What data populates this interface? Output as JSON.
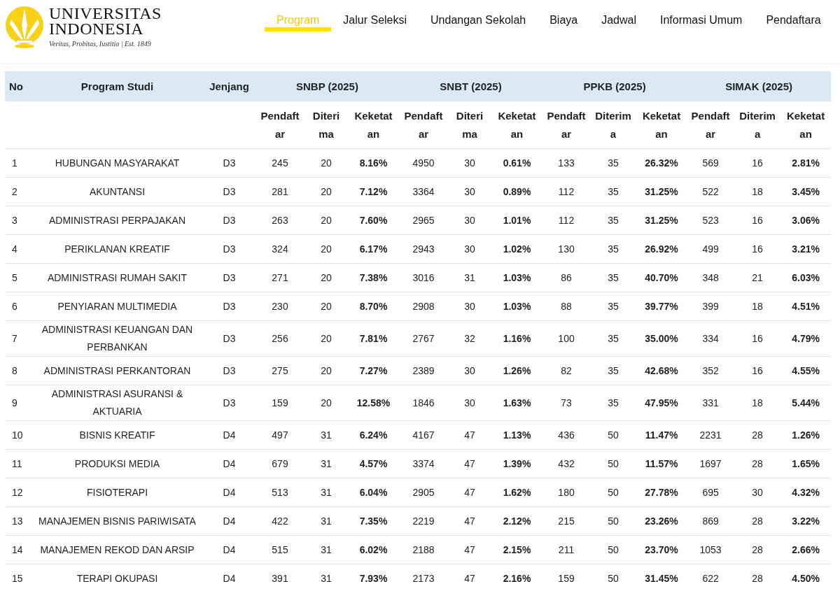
{
  "logo": {
    "name_line1": "UNIVERSITAS",
    "name_line2": "INDONESIA",
    "motto": "Veritas, Probitas, Iustitia | Est. 1849"
  },
  "nav": [
    {
      "label": "Program",
      "selected": true
    },
    {
      "label": "Jalur Seleksi",
      "selected": false
    },
    {
      "label": "Undangan Sekolah",
      "selected": false
    },
    {
      "label": "Biaya",
      "selected": false
    },
    {
      "label": "Jadwal",
      "selected": false
    },
    {
      "label": "Informasi Umum",
      "selected": false
    },
    {
      "label": "Pendaftara",
      "selected": false
    }
  ],
  "table": {
    "columns": [
      "No",
      "Program Studi",
      "Jenjang"
    ],
    "groups": [
      {
        "title": "SNBP (2025)",
        "subcolumns": [
          "Pendaftar",
          "Diterima",
          "Keketatan"
        ]
      },
      {
        "title": "SNBT (2025)",
        "subcolumns": [
          "Pendaftar",
          "Diterima",
          "Keketatan"
        ]
      },
      {
        "title": "PPKB (2025)",
        "subcolumns": [
          "Pendaftar",
          "Diterima",
          "Keketatan"
        ]
      },
      {
        "title": "SIMAK (2025)",
        "subcolumns": [
          "Pendaftar",
          "Diterima",
          "Keketatan"
        ]
      }
    ],
    "rows": [
      {
        "no": "1",
        "program": "HUBUNGAN MASYARAKAT",
        "level": "D3",
        "values": [
          "245",
          "20",
          "8.16%",
          "4950",
          "30",
          "0.61%",
          "133",
          "35",
          "26.32%",
          "569",
          "16",
          "2.81%"
        ]
      },
      {
        "no": "2",
        "program": "AKUNTANSI",
        "level": "D3",
        "values": [
          "281",
          "20",
          "7.12%",
          "3364",
          "30",
          "0.89%",
          "112",
          "35",
          "31.25%",
          "522",
          "18",
          "3.45%"
        ]
      },
      {
        "no": "3",
        "program": "ADMINISTRASI PERPAJAKAN",
        "level": "D3",
        "values": [
          "263",
          "20",
          "7.60%",
          "2965",
          "30",
          "1.01%",
          "112",
          "35",
          "31.25%",
          "523",
          "16",
          "3.06%"
        ]
      },
      {
        "no": "4",
        "program": "PERIKLANAN KREATIF",
        "level": "D3",
        "values": [
          "324",
          "20",
          "6.17%",
          "2943",
          "30",
          "1.02%",
          "130",
          "35",
          "26.92%",
          "499",
          "16",
          "3.21%"
        ]
      },
      {
        "no": "5",
        "program": "ADMINISTRASI RUMAH SAKIT",
        "level": "D3",
        "values": [
          "271",
          "20",
          "7.38%",
          "3016",
          "31",
          "1.03%",
          "86",
          "35",
          "40.70%",
          "348",
          "21",
          "6.03%"
        ]
      },
      {
        "no": "6",
        "program": "PENYIARAN MULTIMEDIA",
        "level": "D3",
        "values": [
          "230",
          "20",
          "8.70%",
          "2908",
          "30",
          "1.03%",
          "88",
          "35",
          "39.77%",
          "399",
          "18",
          "4.51%"
        ]
      },
      {
        "no": "7",
        "program": "ADMINISTRASI KEUANGAN DAN PERBANKAN",
        "level": "D3",
        "values": [
          "256",
          "20",
          "7.81%",
          "2767",
          "32",
          "1.16%",
          "100",
          "35",
          "35.00%",
          "334",
          "16",
          "4.79%"
        ]
      },
      {
        "no": "8",
        "program": "ADMINISTRASI PERKANTORAN",
        "level": "D3",
        "values": [
          "275",
          "20",
          "7.27%",
          "2389",
          "30",
          "1.26%",
          "82",
          "35",
          "42.68%",
          "352",
          "16",
          "4.55%"
        ]
      },
      {
        "no": "9",
        "program": "ADMINISTRASI ASURANSI & AKTUARIA",
        "level": "D3",
        "values": [
          "159",
          "20",
          "12.58%",
          "1846",
          "30",
          "1.63%",
          "73",
          "35",
          "47.95%",
          "331",
          "18",
          "5.44%"
        ]
      },
      {
        "no": "10",
        "program": "BISNIS KREATIF",
        "level": "D4",
        "values": [
          "497",
          "31",
          "6.24%",
          "4167",
          "47",
          "1.13%",
          "436",
          "50",
          "11.47%",
          "2231",
          "28",
          "1.26%"
        ]
      },
      {
        "no": "11",
        "program": "PRODUKSI MEDIA",
        "level": "D4",
        "values": [
          "679",
          "31",
          "4.57%",
          "3374",
          "47",
          "1.39%",
          "432",
          "50",
          "11.57%",
          "1697",
          "28",
          "1.65%"
        ]
      },
      {
        "no": "12",
        "program": "FISIOTERAPI",
        "level": "D4",
        "values": [
          "513",
          "31",
          "6.04%",
          "2905",
          "47",
          "1.62%",
          "180",
          "50",
          "27.78%",
          "695",
          "30",
          "4.32%"
        ]
      },
      {
        "no": "13",
        "program": "MANAJEMEN BISNIS PARIWISATA",
        "level": "D4",
        "values": [
          "422",
          "31",
          "7.35%",
          "2219",
          "47",
          "2.12%",
          "215",
          "50",
          "23.26%",
          "869",
          "28",
          "3.22%"
        ]
      },
      {
        "no": "14",
        "program": "MANAJEMEN REKOD DAN ARSIP",
        "level": "D4",
        "values": [
          "515",
          "31",
          "6.02%",
          "2188",
          "47",
          "2.15%",
          "211",
          "50",
          "23.70%",
          "1053",
          "28",
          "2.66%"
        ]
      },
      {
        "no": "15",
        "program": "TERAPI OKUPASI",
        "level": "D4",
        "values": [
          "391",
          "31",
          "7.93%",
          "2173",
          "47",
          "2.16%",
          "159",
          "50",
          "31.45%",
          "622",
          "28",
          "4.50%"
        ]
      }
    ]
  }
}
